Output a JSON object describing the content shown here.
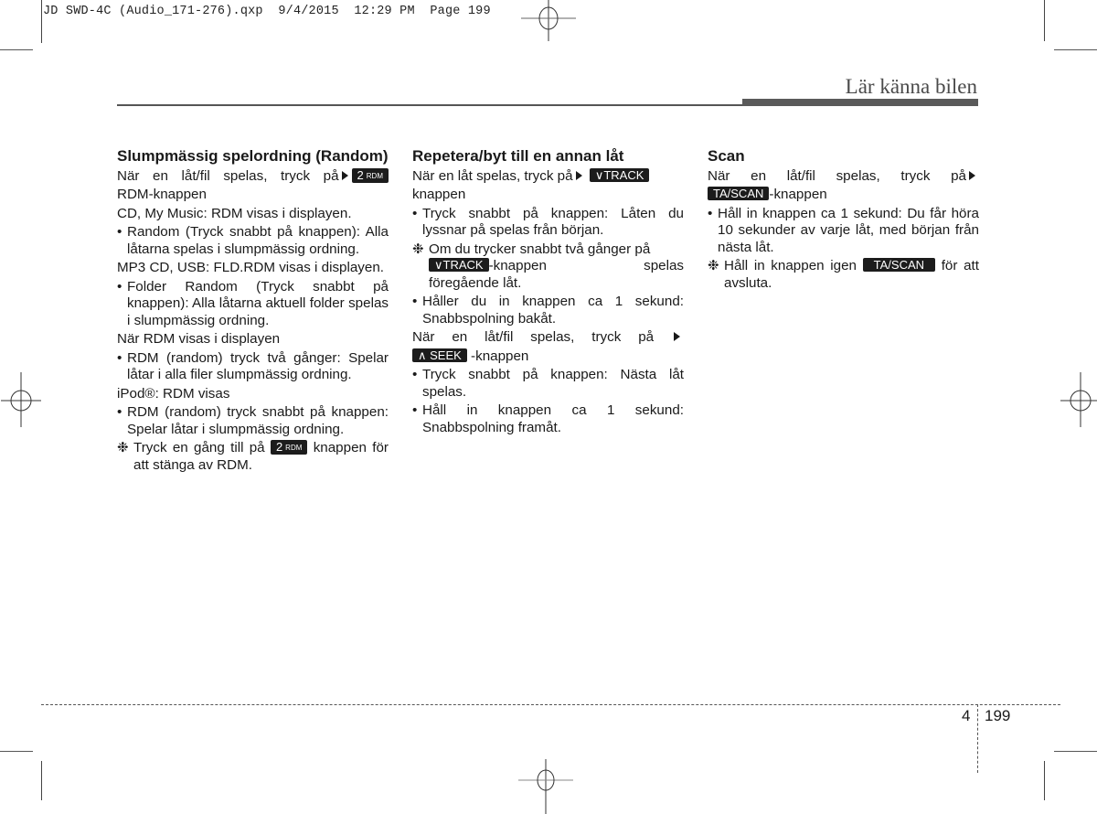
{
  "slug": {
    "text": "JD SWD-4C (Audio_171-276).qxp  9/4/2015  12:29 PM  Page 199"
  },
  "header": {
    "title": "Lär känna bilen"
  },
  "columns": [
    {
      "heading": "Slumpmässig spelordning (Random)",
      "blocks": {
        "intro_text": "När en låt/fil spelas, tryck på",
        "intro_button": {
          "big": "2",
          "small": "RDM"
        },
        "intro_after": "RDM-knappen",
        "cd_line": "CD, My Music: RDM visas i displayen.",
        "bullet1": "Random (Tryck snabbt på knappen): Alla låtarna spelas i slumpmässig ordning.",
        "mp3_line": "MP3 CD, USB: FLD.RDM visas i displayen.",
        "bullet2": "Folder Random (Tryck snabbt på knappen): Alla låtarna aktuell folder spelas i slumpmässig ordning.",
        "rdm_line": "När RDM visas i displayen",
        "bullet3": "RDM (random) tryck två gånger: Spelar låtar i alla filer slumpmässig ordning.",
        "ipod_line": "iPod®: RDM visas",
        "bullet4": "RDM (random) tryck snabbt på knappen: Spelar låtar i slumpmässig ordning.",
        "note_before": "Tryck en gång till på",
        "note_button": {
          "big": "2",
          "small": "RDM"
        },
        "note_after": "knappen för att stänga av RDM."
      }
    },
    {
      "heading": "Repetera/byt till en annan låt",
      "blocks": {
        "intro_text": "När en låt spelas, tryck på",
        "intro_button": "∨TRACK",
        "intro_after": "knappen",
        "bullet1": "Tryck snabbt på knappen: Låten du lyssnar på spelas från början.",
        "note_before": "Om du trycker snabbt två gånger på",
        "note_button": "∨TRACK",
        "note_mid": "-knappen",
        "note_after": "spelas föregående låt.",
        "bullet2": "Håller du in knappen ca 1 sekund: Snabbspolning bakåt.",
        "seek_intro": "När en låt/fil spelas, tryck på",
        "seek_button": "∧ SEEK",
        "seek_after": "-knappen",
        "bullet3": "Tryck snabbt på knappen: Nästa låt spelas.",
        "bullet4": "Håll in knappen ca 1 sekund: Snabbspolning framåt."
      }
    },
    {
      "heading": "Scan",
      "blocks": {
        "intro_text": "När en låt/fil spelas, tryck på",
        "intro_button": "TA/SCAN",
        "intro_after": "-knappen",
        "bullet1": "Håll in knappen ca 1 sekund: Du får höra 10 sekunder av varje låt, med början från nästa låt.",
        "note_before": "Håll in knappen igen",
        "note_button": "TA/SCAN",
        "note_after": "för att avsluta."
      }
    }
  ],
  "markers": {
    "bullet": "•",
    "note": "❉"
  },
  "footer": {
    "section": "4",
    "page": "199"
  }
}
